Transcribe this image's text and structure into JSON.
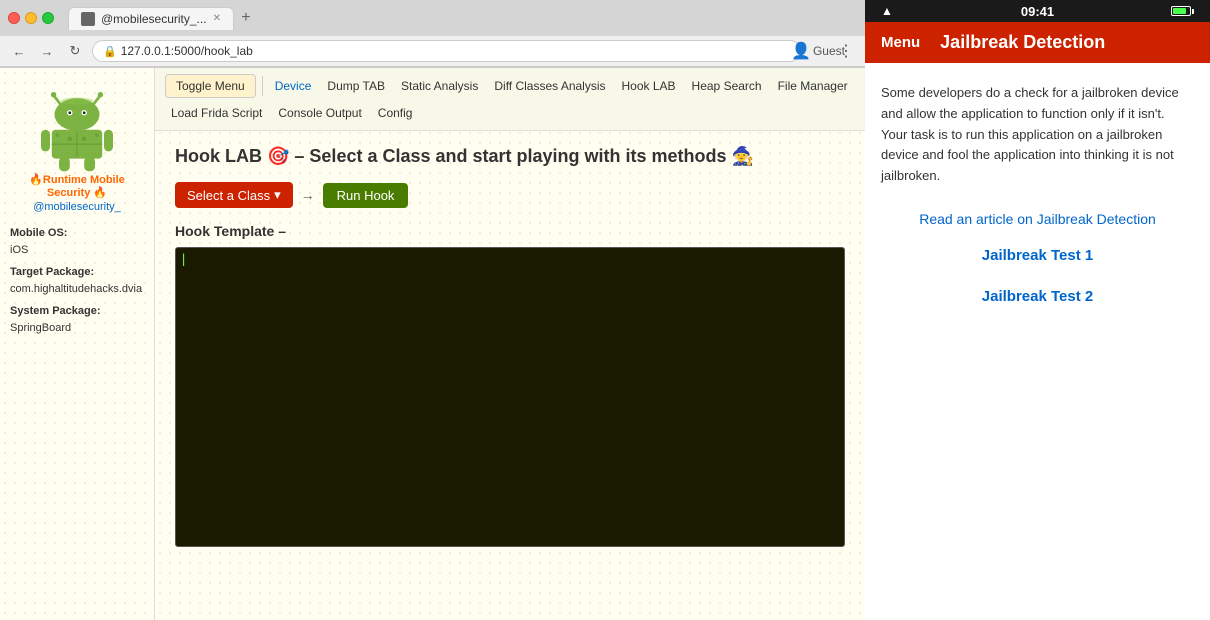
{
  "browser": {
    "tab_label": "@mobilesecurity_...",
    "address": "127.0.0.1:5000/hook_lab",
    "address_prefix": "127.0.0.1:5000/hook_lab",
    "user_label": "Guest"
  },
  "toolbar": {
    "toggle_menu": "Toggle Menu",
    "nav_items": [
      {
        "id": "device",
        "label": "Device",
        "active": true
      },
      {
        "id": "dump_tab",
        "label": "Dump TAB"
      },
      {
        "id": "static_analysis",
        "label": "Static Analysis"
      },
      {
        "id": "diff_classes",
        "label": "Diff Classes Analysis"
      },
      {
        "id": "hook_lab",
        "label": "Hook LAB"
      },
      {
        "id": "heap_search",
        "label": "Heap Search"
      },
      {
        "id": "file_manager",
        "label": "File Manager"
      },
      {
        "id": "load_frida",
        "label": "Load Frida Script"
      },
      {
        "id": "console_output",
        "label": "Console Output"
      },
      {
        "id": "config",
        "label": "Config"
      }
    ]
  },
  "sidebar": {
    "brand": "🔥Runtime Mobile Security 🔥",
    "handle": "@mobilesecurity_",
    "mobile_os_label": "Mobile OS:",
    "mobile_os_value": "iOS",
    "target_package_label": "Target Package:",
    "target_package_value": "com.highaltitudehacks.dvia",
    "system_package_label": "System Package:",
    "system_package_value": "SpringBoard"
  },
  "hooklab": {
    "title": "Hook LAB 🎯 – Select a Class and start playing with its methods 🧙",
    "select_label": "Select a Class",
    "run_label": "Run Hook",
    "template_label": "Hook Template –"
  },
  "device": {
    "status_time": "09:41",
    "header_menu": "Menu",
    "header_title": "Jailbreak Detection",
    "description": "Some developers do a check for a jailbroken device and allow the application to function only if it isn't. Your task is to run this application on a jailbroken device and fool the application into thinking it is not jailbroken.",
    "article_link": "Read an article on Jailbreak Detection",
    "test1_label": "Jailbreak Test 1",
    "test2_label": "Jailbreak Test 2"
  }
}
